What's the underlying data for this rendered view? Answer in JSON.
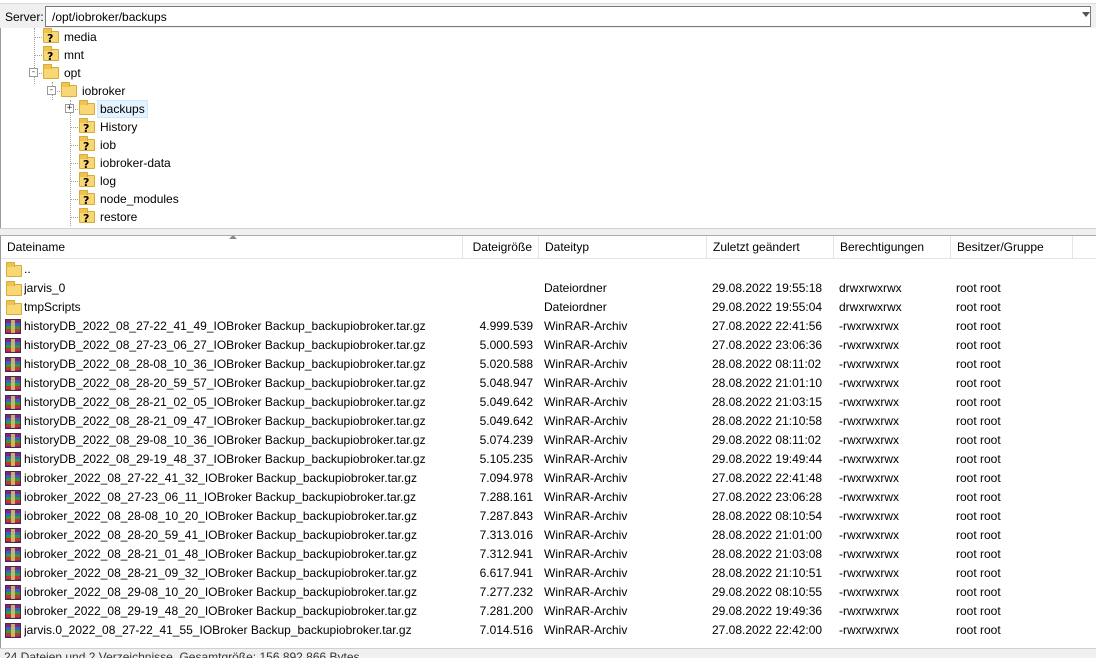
{
  "pathbar": {
    "label": "Server:",
    "path": "/opt/iobroker/backups"
  },
  "tree": [
    {
      "label": "media",
      "icon": "unknown-folder-icon",
      "depth": 2
    },
    {
      "label": "mnt",
      "icon": "unknown-folder-icon",
      "depth": 2
    },
    {
      "label": "opt",
      "icon": "folder-icon",
      "depth": 2,
      "expander": "−"
    },
    {
      "label": "iobroker",
      "icon": "folder-icon",
      "depth": 3,
      "expander": "−"
    },
    {
      "label": "backups",
      "icon": "folder-icon",
      "depth": 4,
      "expander": "+",
      "selected": true
    },
    {
      "label": "History",
      "icon": "unknown-folder-icon",
      "depth": 4
    },
    {
      "label": "iob",
      "icon": "unknown-folder-icon",
      "depth": 4
    },
    {
      "label": "iobroker-data",
      "icon": "unknown-folder-icon",
      "depth": 4
    },
    {
      "label": "log",
      "icon": "unknown-folder-icon",
      "depth": 4
    },
    {
      "label": "node_modules",
      "icon": "unknown-folder-icon",
      "depth": 4
    },
    {
      "label": "restore",
      "icon": "unknown-folder-icon",
      "depth": 4
    }
  ],
  "columns": {
    "name": "Dateiname",
    "size": "Dateigröße",
    "type": "Dateityp",
    "modified": "Zuletzt geändert",
    "perms": "Berechtigungen",
    "owner": "Besitzer/Gruppe"
  },
  "files": [
    {
      "name": "..",
      "size": "",
      "type": "",
      "modified": "",
      "perms": "",
      "owner": "",
      "icon": "folder-icon"
    },
    {
      "name": "jarvis_0",
      "size": "",
      "type": "Dateiordner",
      "modified": "29.08.2022 19:55:18",
      "perms": "drwxrwxrwx",
      "owner": "root root",
      "icon": "folder-icon"
    },
    {
      "name": "tmpScripts",
      "size": "",
      "type": "Dateiordner",
      "modified": "29.08.2022 19:55:04",
      "perms": "drwxrwxrwx",
      "owner": "root root",
      "icon": "folder-icon"
    },
    {
      "name": "historyDB_2022_08_27-22_41_49_IOBroker Backup_backupiobroker.tar.gz",
      "size": "4.999.539",
      "type": "WinRAR-Archiv",
      "modified": "27.08.2022 22:41:56",
      "perms": "-rwxrwxrwx",
      "owner": "root root",
      "icon": "archive-icon"
    },
    {
      "name": "historyDB_2022_08_27-23_06_27_IOBroker Backup_backupiobroker.tar.gz",
      "size": "5.000.593",
      "type": "WinRAR-Archiv",
      "modified": "27.08.2022 23:06:36",
      "perms": "-rwxrwxrwx",
      "owner": "root root",
      "icon": "archive-icon"
    },
    {
      "name": "historyDB_2022_08_28-08_10_36_IOBroker Backup_backupiobroker.tar.gz",
      "size": "5.020.588",
      "type": "WinRAR-Archiv",
      "modified": "28.08.2022 08:11:02",
      "perms": "-rwxrwxrwx",
      "owner": "root root",
      "icon": "archive-icon"
    },
    {
      "name": "historyDB_2022_08_28-20_59_57_IOBroker Backup_backupiobroker.tar.gz",
      "size": "5.048.947",
      "type": "WinRAR-Archiv",
      "modified": "28.08.2022 21:01:10",
      "perms": "-rwxrwxrwx",
      "owner": "root root",
      "icon": "archive-icon"
    },
    {
      "name": "historyDB_2022_08_28-21_02_05_IOBroker Backup_backupiobroker.tar.gz",
      "size": "5.049.642",
      "type": "WinRAR-Archiv",
      "modified": "28.08.2022 21:03:15",
      "perms": "-rwxrwxrwx",
      "owner": "root root",
      "icon": "archive-icon"
    },
    {
      "name": "historyDB_2022_08_28-21_09_47_IOBroker Backup_backupiobroker.tar.gz",
      "size": "5.049.642",
      "type": "WinRAR-Archiv",
      "modified": "28.08.2022 21:10:58",
      "perms": "-rwxrwxrwx",
      "owner": "root root",
      "icon": "archive-icon"
    },
    {
      "name": "historyDB_2022_08_29-08_10_36_IOBroker Backup_backupiobroker.tar.gz",
      "size": "5.074.239",
      "type": "WinRAR-Archiv",
      "modified": "29.08.2022 08:11:02",
      "perms": "-rwxrwxrwx",
      "owner": "root root",
      "icon": "archive-icon"
    },
    {
      "name": "historyDB_2022_08_29-19_48_37_IOBroker Backup_backupiobroker.tar.gz",
      "size": "5.105.235",
      "type": "WinRAR-Archiv",
      "modified": "29.08.2022 19:49:44",
      "perms": "-rwxrwxrwx",
      "owner": "root root",
      "icon": "archive-icon"
    },
    {
      "name": "iobroker_2022_08_27-22_41_32_IOBroker Backup_backupiobroker.tar.gz",
      "size": "7.094.978",
      "type": "WinRAR-Archiv",
      "modified": "27.08.2022 22:41:48",
      "perms": "-rwxrwxrwx",
      "owner": "root root",
      "icon": "archive-icon"
    },
    {
      "name": "iobroker_2022_08_27-23_06_11_IOBroker Backup_backupiobroker.tar.gz",
      "size": "7.288.161",
      "type": "WinRAR-Archiv",
      "modified": "27.08.2022 23:06:28",
      "perms": "-rwxrwxrwx",
      "owner": "root root",
      "icon": "archive-icon"
    },
    {
      "name": "iobroker_2022_08_28-08_10_20_IOBroker Backup_backupiobroker.tar.gz",
      "size": "7.287.843",
      "type": "WinRAR-Archiv",
      "modified": "28.08.2022 08:10:54",
      "perms": "-rwxrwxrwx",
      "owner": "root root",
      "icon": "archive-icon"
    },
    {
      "name": "iobroker_2022_08_28-20_59_41_IOBroker Backup_backupiobroker.tar.gz",
      "size": "7.313.016",
      "type": "WinRAR-Archiv",
      "modified": "28.08.2022 21:01:00",
      "perms": "-rwxrwxrwx",
      "owner": "root root",
      "icon": "archive-icon"
    },
    {
      "name": "iobroker_2022_08_28-21_01_48_IOBroker Backup_backupiobroker.tar.gz",
      "size": "7.312.941",
      "type": "WinRAR-Archiv",
      "modified": "28.08.2022 21:03:08",
      "perms": "-rwxrwxrwx",
      "owner": "root root",
      "icon": "archive-icon"
    },
    {
      "name": "iobroker_2022_08_28-21_09_32_IOBroker Backup_backupiobroker.tar.gz",
      "size": "6.617.941",
      "type": "WinRAR-Archiv",
      "modified": "28.08.2022 21:10:51",
      "perms": "-rwxrwxrwx",
      "owner": "root root",
      "icon": "archive-icon"
    },
    {
      "name": "iobroker_2022_08_29-08_10_20_IOBroker Backup_backupiobroker.tar.gz",
      "size": "7.277.232",
      "type": "WinRAR-Archiv",
      "modified": "29.08.2022 08:10:55",
      "perms": "-rwxrwxrwx",
      "owner": "root root",
      "icon": "archive-icon"
    },
    {
      "name": "iobroker_2022_08_29-19_48_20_IOBroker Backup_backupiobroker.tar.gz",
      "size": "7.281.200",
      "type": "WinRAR-Archiv",
      "modified": "29.08.2022 19:49:36",
      "perms": "-rwxrwxrwx",
      "owner": "root root",
      "icon": "archive-icon"
    },
    {
      "name": "jarvis.0_2022_08_27-22_41_55_IOBroker Backup_backupiobroker.tar.gz",
      "size": "7.014.516",
      "type": "WinRAR-Archiv",
      "modified": "27.08.2022 22:42:00",
      "perms": "-rwxrwxrwx",
      "owner": "root root",
      "icon": "archive-icon"
    }
  ],
  "status": "24 Dateien und 2 Verzeichnisse. Gesamtgröße: 156.892.866 Bytes"
}
